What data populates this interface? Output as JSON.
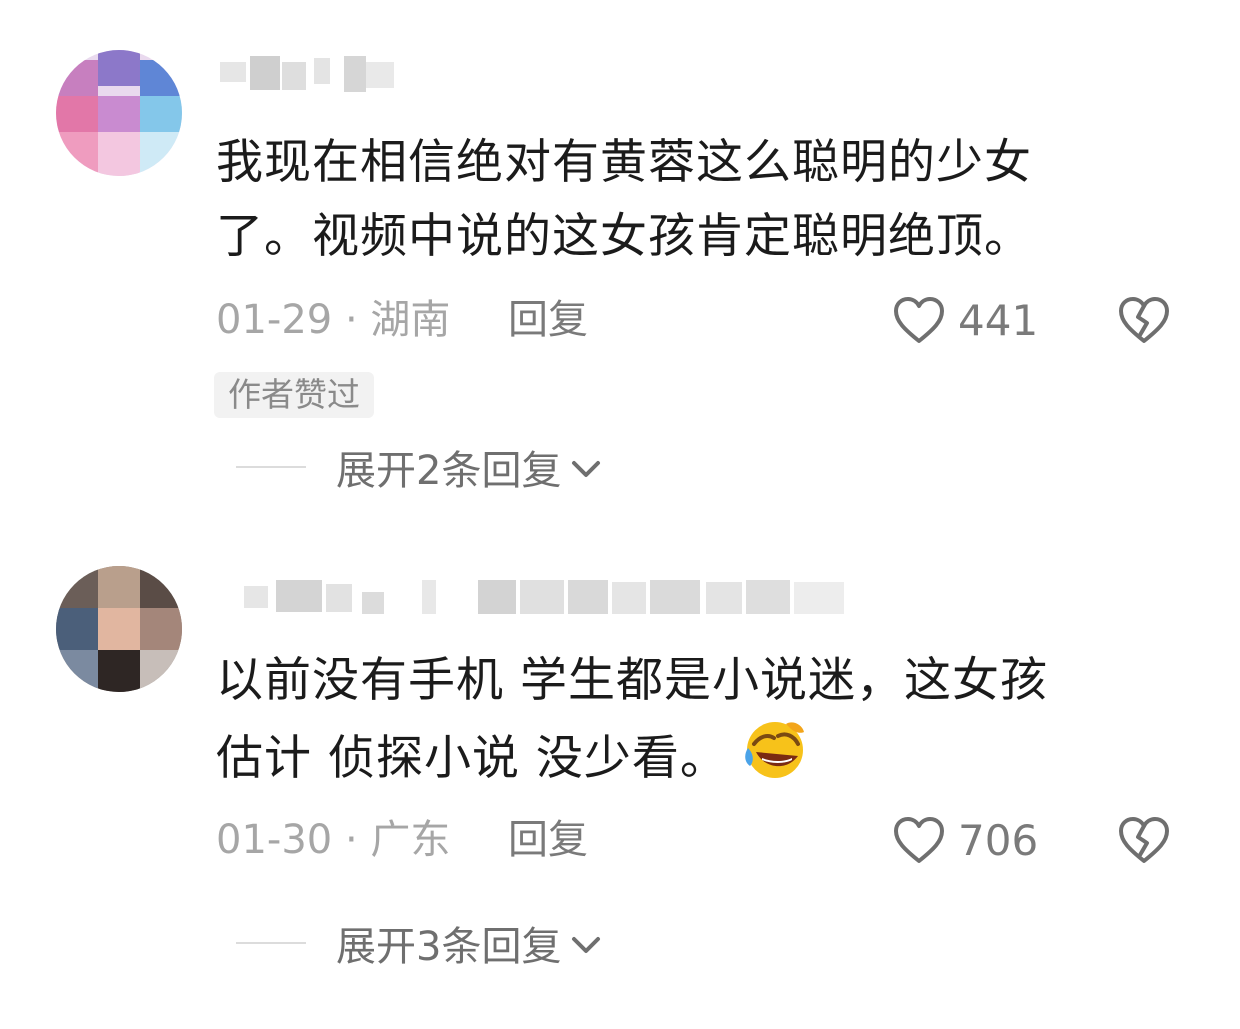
{
  "comments": [
    {
      "text_line1": "我现在相信绝对有黄蓉这么聪明的少女",
      "text_line2": "了。视频中说的这女孩肯定聪明绝顶。",
      "date_location": "01-29 · 湖南",
      "reply_label": "回复",
      "like_count": "441",
      "author_badge": "作者赞过",
      "expand_label": "展开2条回复"
    },
    {
      "text_line1": "以前没有手机  学生都是小说迷，这女孩",
      "text_line2": "估计 侦探小说 没少看。",
      "emoji": "rofl-emoji",
      "date_location": "01-30 · 广东",
      "reply_label": "回复",
      "like_count": "706",
      "expand_label": "展开3条回复"
    }
  ],
  "icons": {
    "like": "heart-outline-icon",
    "dislike": "broken-heart-icon",
    "expand": "chevron-down-icon"
  },
  "colors": {
    "text": "#1b1b1b",
    "meta": "#a6a6a6",
    "icon": "#6f6f6f",
    "badge_bg": "#f2f2f2"
  }
}
